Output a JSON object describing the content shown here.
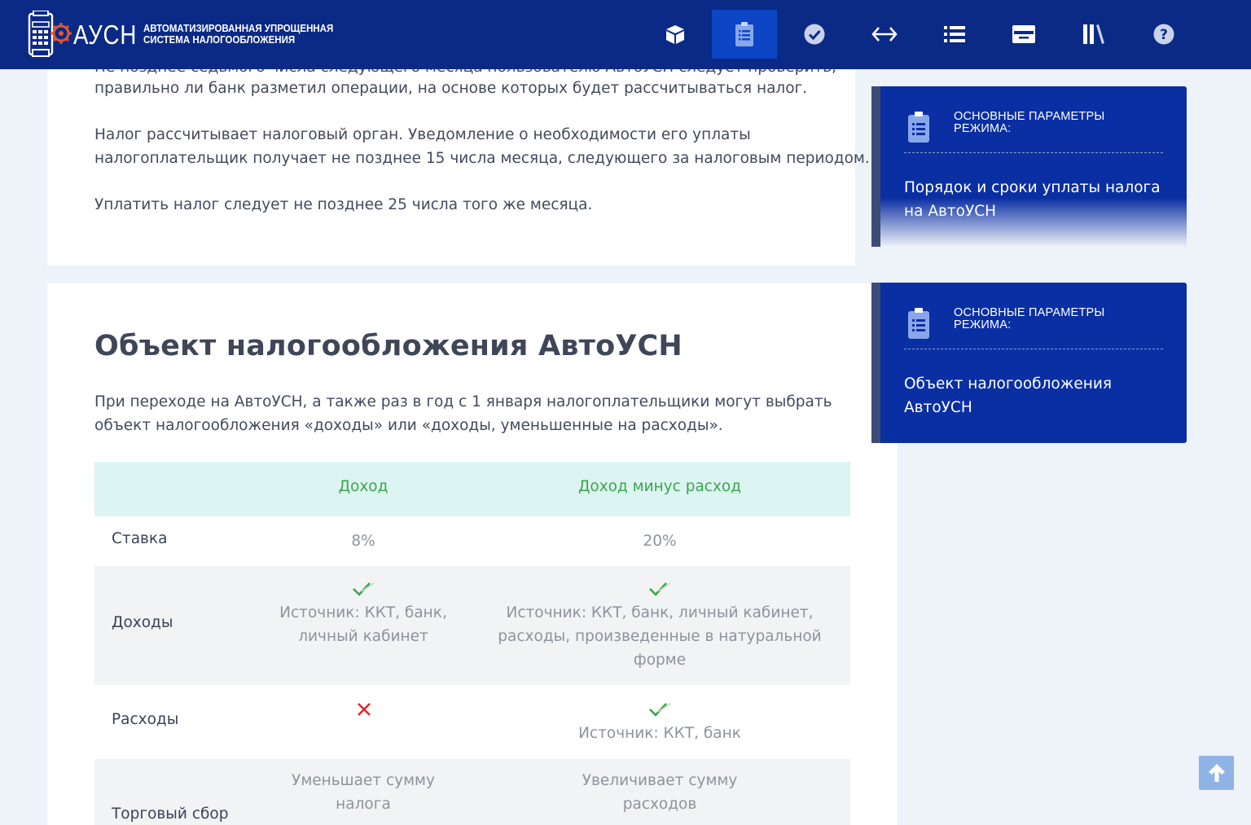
{
  "header": {
    "logo_word": "АУСН",
    "logo_sub_line1": "АВТОМАТИЗИРОВАННАЯ УПРОЩЕННАЯ",
    "logo_sub_line2": "СИСТЕМА НАЛОГООБЛОЖЕНИЯ",
    "nav": [
      {
        "icon": "cube-icon",
        "active": false
      },
      {
        "icon": "clipboard-icon",
        "active": true
      },
      {
        "icon": "check-circle-icon",
        "active": false
      },
      {
        "icon": "code-arrows-icon",
        "active": false
      },
      {
        "icon": "list-icon",
        "active": false
      },
      {
        "icon": "card-icon",
        "active": false
      },
      {
        "icon": "library-icon",
        "active": false
      },
      {
        "icon": "help-icon",
        "active": false
      }
    ],
    "colors": {
      "bar": "#0b2a86",
      "active": "#0d46c4"
    }
  },
  "card1": {
    "cut_line": "Не позднее седьмого числа следующего месяца пользователю АвтоУСН следует проверить,",
    "line1": "правильно ли банк разметил операции, на основе которых будет рассчитываться налог.",
    "line2": "Налог рассчитывает налоговый орган. Уведомление о необходимости его уплаты",
    "line3": "налогоплательщик получает не позднее 15 числа месяца, следующего за налоговым периодом.",
    "line4": "Уплатить налог следует не позднее 25 числа того же месяца."
  },
  "section": {
    "title": "Объект налогообложения АвтоУСН",
    "intro1": "При переходе на АвтоУСН, а также раз в год с 1 января налогоплательщики могут выбрать",
    "intro2": "объект налогообложения «доходы» или «доходы, уменьшенные на расходы»."
  },
  "table": {
    "headers": [
      "",
      "Доход",
      "Доход минус расход"
    ],
    "rows": [
      {
        "label": "Ставка",
        "a": "8%",
        "b": "20%"
      },
      {
        "label": "Доходы",
        "a_mark": "check",
        "a_lines": [
          "Источник: ККТ, банк,",
          "личный кабинет"
        ],
        "b_mark": "check",
        "b_lines": [
          "Источник: ККТ, банк, личный кабинет,",
          "расходы, произведенные в натуральной",
          "форме"
        ]
      },
      {
        "label": "Расходы",
        "a_mark": "cross",
        "b_mark": "check",
        "b_lines": [
          "Источник: ККТ, банк"
        ]
      },
      {
        "label": "Торговый сбор",
        "a_lines": [
          "Уменьшает сумму",
          "налога"
        ],
        "b_lines": [
          "Увеличивает сумму",
          "расходов"
        ]
      }
    ],
    "colors": {
      "header_bg": "#dcf4f2",
      "header_text": "#3aa64c",
      "check": "#3aa64c",
      "cross": "#e02a2a"
    }
  },
  "sidebar": {
    "cards": [
      {
        "caption_line1": "ОСНОВНЫЕ ПАРАМЕТРЫ",
        "caption_line2": "РЕЖИМА:",
        "link_line1": "Порядок и сроки уплаты налога",
        "link_line2": "на АвтоУСН"
      },
      {
        "caption_line1": "ОСНОВНЫЕ ПАРАМЕТРЫ",
        "caption_line2": "РЕЖИМА:",
        "link_line1": "Объект налогообложения",
        "link_line2": "АвтоУСН"
      }
    ],
    "colors": {
      "card_bg": "#0a2fa3",
      "edge": "#3d4b78"
    }
  },
  "scroll_top": {
    "icon": "arrow-up-icon"
  }
}
